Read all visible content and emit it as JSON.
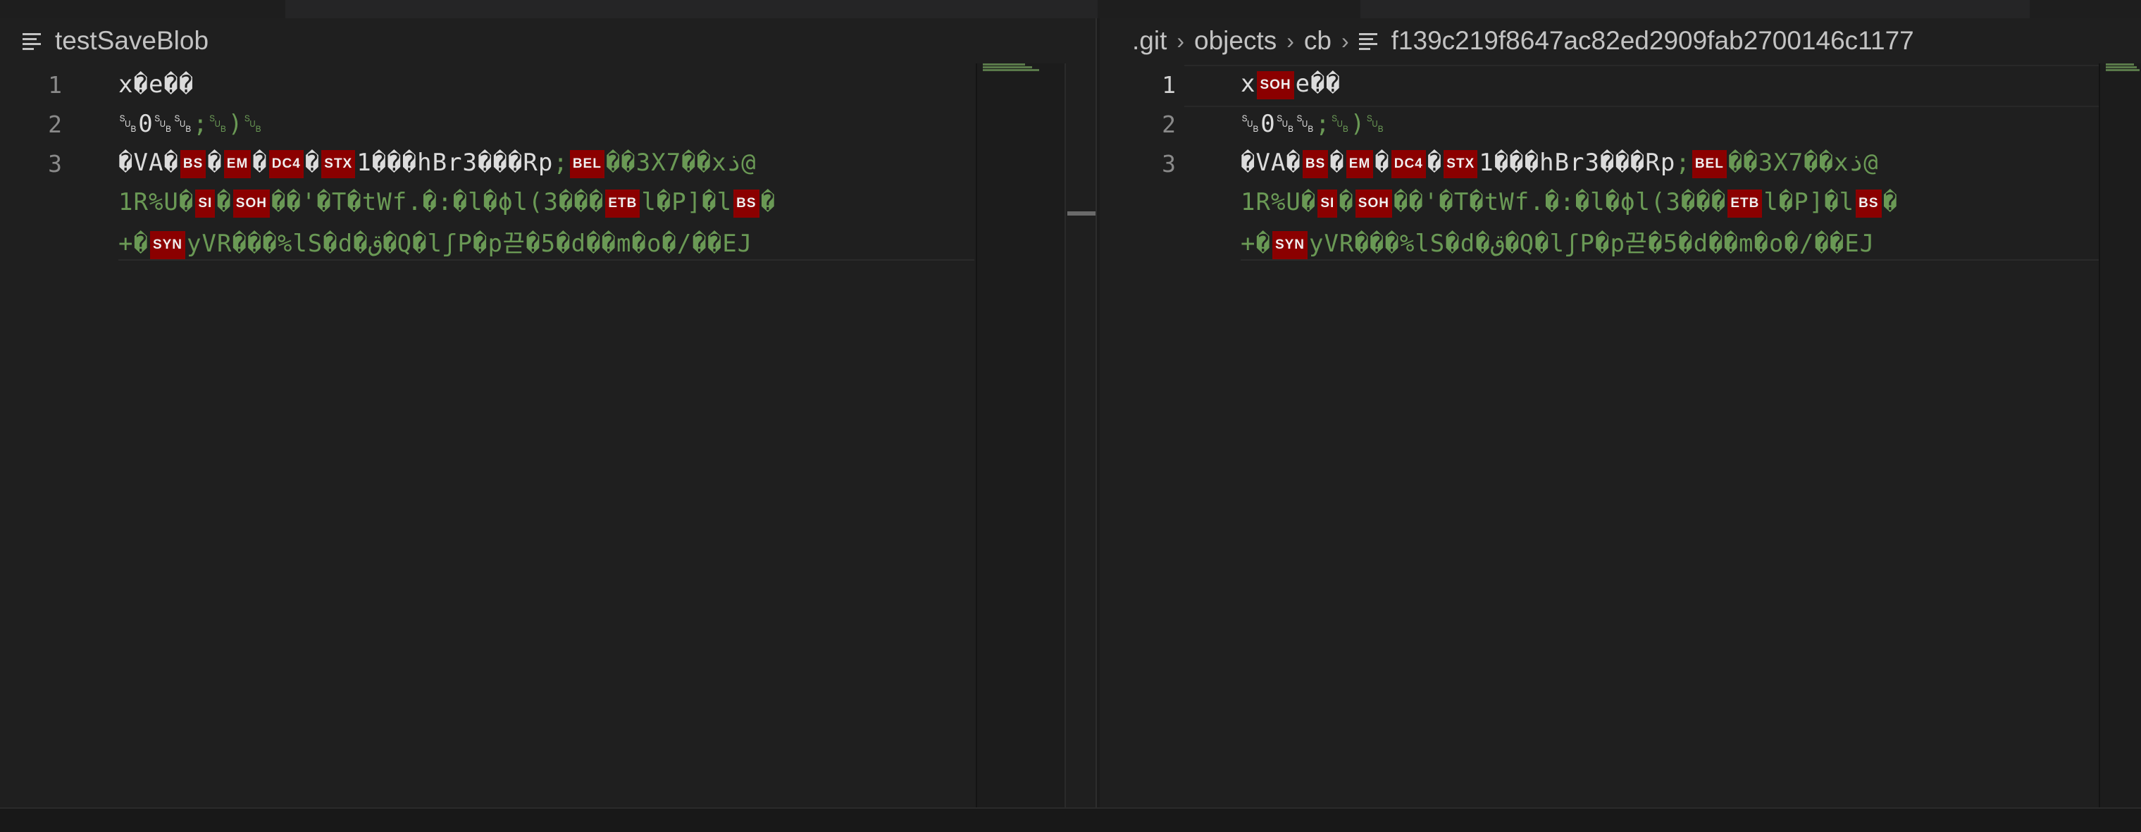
{
  "left_editor": {
    "breadcrumb": [
      "testSaveBlob"
    ],
    "lines": [
      {
        "number": "1",
        "segments": [
          {
            "t": "x�e��",
            "c": "white"
          }
        ]
      },
      {
        "number": "2",
        "segments": [
          {
            "t": "␚0␚␚",
            "c": "white"
          },
          {
            "t": ";␚)␚",
            "c": "green"
          }
        ]
      },
      {
        "number": "3",
        "segments": [
          {
            "t": "�VA�",
            "c": "white"
          },
          {
            "ctl": "BS"
          },
          {
            "t": "�",
            "c": "white"
          },
          {
            "ctl": "EM"
          },
          {
            "t": "�",
            "c": "white"
          },
          {
            "ctl": "DC4"
          },
          {
            "t": "�",
            "c": "white"
          },
          {
            "ctl": "STX"
          },
          {
            "t": "1���hBr3���Rp",
            "c": "white"
          },
          {
            "t": ";",
            "c": "green"
          },
          {
            "ctl": "BEL"
          },
          {
            "t": "��3X7��xذ@",
            "c": "green"
          }
        ]
      },
      {
        "number": "",
        "segments": [
          {
            "t": "1R%U�",
            "c": "green"
          },
          {
            "ctl": "SI"
          },
          {
            "t": "�",
            "c": "green"
          },
          {
            "ctl": "SOH"
          },
          {
            "t": "��'�T�tWf.�:�l�ϕl(3���",
            "c": "green"
          },
          {
            "ctl": "ETB"
          },
          {
            "t": "l�P]�l",
            "c": "green"
          },
          {
            "ctl": "BS"
          },
          {
            "t": "�",
            "c": "green"
          }
        ]
      },
      {
        "number": "",
        "segments": [
          {
            "t": "+�",
            "c": "green"
          },
          {
            "ctl": "SYN"
          },
          {
            "t": "yVR���%lS�d�ق�Q�lʃP�p끋�5�d��m�o�/��EJ",
            "c": "green"
          }
        ]
      }
    ]
  },
  "right_editor": {
    "breadcrumb": [
      ".git",
      "objects",
      "cb",
      "f139c219f8647ac82ed2909fab2700146c1177"
    ],
    "lines": [
      {
        "number": "1",
        "segments": [
          {
            "t": "x",
            "c": "white"
          },
          {
            "ctl": "SOH"
          },
          {
            "t": "e��",
            "c": "white"
          }
        ]
      },
      {
        "number": "2",
        "segments": [
          {
            "t": "␚0␚␚",
            "c": "white"
          },
          {
            "t": ";␚)␚",
            "c": "green"
          }
        ]
      },
      {
        "number": "3",
        "segments": [
          {
            "t": "�VA�",
            "c": "white"
          },
          {
            "ctl": "BS"
          },
          {
            "t": "�",
            "c": "white"
          },
          {
            "ctl": "EM"
          },
          {
            "t": "�",
            "c": "white"
          },
          {
            "ctl": "DC4"
          },
          {
            "t": "�",
            "c": "white"
          },
          {
            "ctl": "STX"
          },
          {
            "t": "1���hBr3���Rp",
            "c": "white"
          },
          {
            "t": ";",
            "c": "green"
          },
          {
            "ctl": "BEL"
          },
          {
            "t": "��3X7��xذ@",
            "c": "green"
          }
        ]
      },
      {
        "number": "",
        "segments": [
          {
            "t": "1R%U�",
            "c": "green"
          },
          {
            "ctl": "SI"
          },
          {
            "t": "�",
            "c": "green"
          },
          {
            "ctl": "SOH"
          },
          {
            "t": "��'�T�tWf.�:�l�ϕl(3���",
            "c": "green"
          },
          {
            "ctl": "ETB"
          },
          {
            "t": "l�P]�l",
            "c": "green"
          },
          {
            "ctl": "BS"
          },
          {
            "t": "�",
            "c": "green"
          }
        ]
      },
      {
        "number": "",
        "segments": [
          {
            "t": "+�",
            "c": "green"
          },
          {
            "ctl": "SYN"
          },
          {
            "t": "yVR���%lS�d�ق�Q�lʃP�p끋�5�d��m�o�/��EJ",
            "c": "green"
          }
        ]
      }
    ]
  },
  "colors": {
    "background": "#1e1e1e",
    "string_green": "#6a9955",
    "text_white": "#dcdcdc",
    "control_char_bg": "#8b0000"
  },
  "icons": [
    "file-lines-icon",
    "chevron-right-icon"
  ]
}
